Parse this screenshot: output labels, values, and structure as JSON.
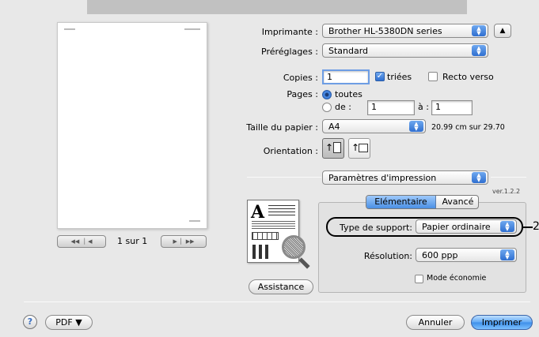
{
  "printer": {
    "label": "Imprimante :",
    "value": "Brother HL-5380DN series"
  },
  "presets": {
    "label": "Préréglages :",
    "value": "Standard"
  },
  "copies": {
    "label": "Copies :",
    "value": "1",
    "collated_label": "triées",
    "duplex_label": "Recto verso"
  },
  "pages": {
    "label": "Pages :",
    "all_label": "toutes",
    "from_label": "de :",
    "from_value": "1",
    "to_label": "à :",
    "to_value": "1"
  },
  "paper_size": {
    "label": "Taille du papier :",
    "value": "A4",
    "dimensions": "20.99 cm sur 29.70"
  },
  "orientation": {
    "label": "Orientation :"
  },
  "section": {
    "value": "Paramètres d'impression",
    "version": "ver.1.2.2"
  },
  "tabs": [
    {
      "label": "Elémentaire"
    },
    {
      "label": "Avancé"
    }
  ],
  "media_type": {
    "label": "Type de support:",
    "value": "Papier ordinaire",
    "callout": "2"
  },
  "resolution": {
    "label": "Résolution:",
    "value": "600 ppp"
  },
  "eco_mode": {
    "label": "Mode économie"
  },
  "assistance_label": "Assistance",
  "preview": {
    "page_indicator": "1 sur 1"
  },
  "footer": {
    "help": "?",
    "pdf_label": "PDF ▼",
    "cancel_label": "Annuler",
    "print_label": "Imprimer"
  },
  "colors": {
    "accent": "#3d8ee9",
    "background": "#e8e8e8"
  }
}
